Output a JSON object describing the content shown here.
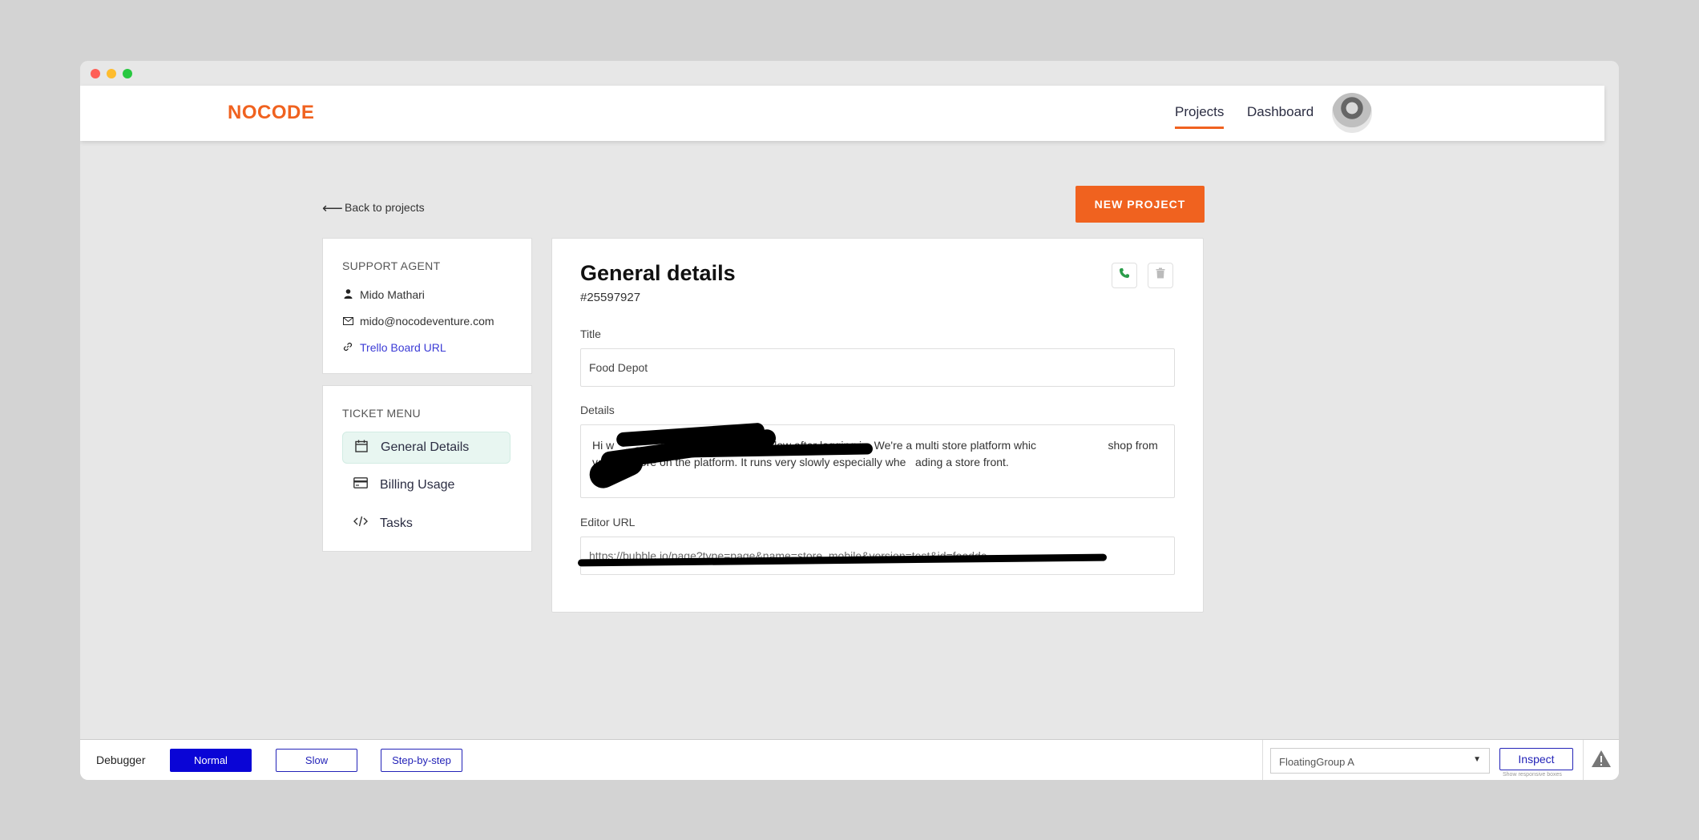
{
  "brand": {
    "logo": "NOCODE",
    "accent": "#f0621f"
  },
  "nav": {
    "projects": "Projects",
    "dashboard": "Dashboard"
  },
  "back_link": "Back to projects",
  "new_project": "NEW PROJECT",
  "agent": {
    "heading": "SUPPORT AGENT",
    "name": "Mido Mathari",
    "email": "mido@nocodeventure.com",
    "link": "Trello Board URL"
  },
  "ticket_menu": {
    "heading": "TICKET MENU",
    "items": [
      {
        "label": "General Details",
        "icon": "calendar-icon",
        "active": true
      },
      {
        "label": "Billing Usage",
        "icon": "credit-card-icon",
        "active": false
      },
      {
        "label": "Tasks",
        "icon": "code-icon",
        "active": false
      }
    ]
  },
  "general": {
    "title": "General details",
    "ticket_id": "#25597927",
    "title_label": "Title",
    "title_value": "Food Depot",
    "details_label": "Details",
    "details_value": "Hi w                                   . It is too slow after logging in. We're a multi store platform whic                       shop from various store on the platform. It runs very slowly especially whe   ading a store front.",
    "editor_label": "Editor URL",
    "editor_value": "https://bubble.io/page?type=page&name=store_mobile&version=test&id=foodde"
  },
  "debugger": {
    "label": "Debugger",
    "normal": "Normal",
    "slow": "Slow",
    "step": "Step-by-step",
    "select_value": "FloatingGroup A",
    "inspect": "Inspect",
    "show_boxes": "Show responsive boxes"
  }
}
